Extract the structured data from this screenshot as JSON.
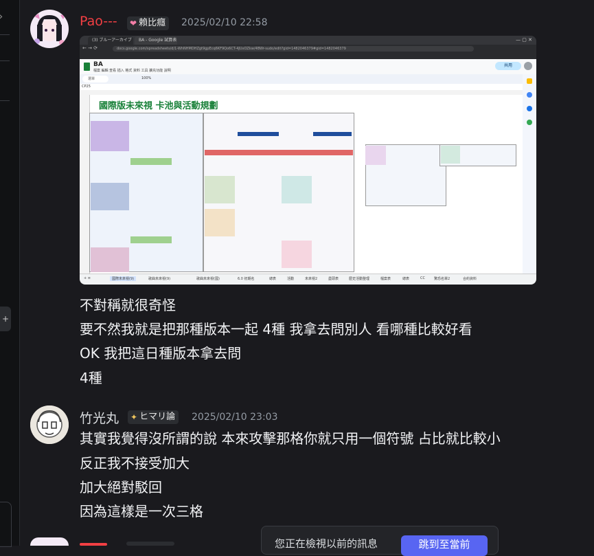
{
  "messages": [
    {
      "username": "Pao---",
      "username_color": "#f23f43",
      "role": "賴比癮",
      "role_icon": "heart-icon",
      "timestamp": "2025/02/10 22:58",
      "lines": [
        "不對稱就很奇怪",
        "要不然我就是把那種版本一起 4種 我拿去問別人 看哪種比較好看",
        "OK 我把這日種版本拿去問",
        "4種"
      ]
    },
    {
      "username": "竹光丸",
      "username_color": "#dbdee1",
      "role": "ヒマリ論",
      "role_icon": "sparkle-icon",
      "timestamp": "2025/02/10 23:03",
      "lines": [
        "其實我覺得沒所謂的說 本來攻擊那格你就只用一個符號 占比就比較小",
        "反正我不接受加大",
        "加大絕對駁回",
        "因為這樣是一次三格"
      ]
    }
  ],
  "embedded_screenshot": {
    "doc_title": "BA",
    "menu": "檔案 編輯 查看 插入 格式 資料 工具 擴充功能 說明",
    "zoom": "100%",
    "share_label": "共用",
    "cell_ref": "CP25",
    "sheet_title": "國際版未來視 卡池與活動規劃",
    "search_placeholder": "選單",
    "url": "docs.google.com/spreadsheets/d/1-WhNHMDHZgt9gpEcq6KF9Qo6CT-4JUxOZkw/4BWr-sudo/edit?gid=1482046379#gid=1482046379",
    "tabs": [
      "(3) ブルーアーカイブ公式 建置版",
      "BA - Google 試算表"
    ],
    "sheet_tabs": [
      "國際未來視(9)",
      "歌曲未來視(9)",
      "歌曲未來視(國)",
      "6.0 初期名",
      "總表",
      "活動",
      "未來視2",
      "盡頭表",
      "歷史活動整理",
      "檔案表",
      "總表",
      "CC",
      "驚恐名單2",
      "合約資料"
    ]
  },
  "toast": {
    "text": "您正在檢視以前的訊息",
    "button": "跳到至當前"
  }
}
